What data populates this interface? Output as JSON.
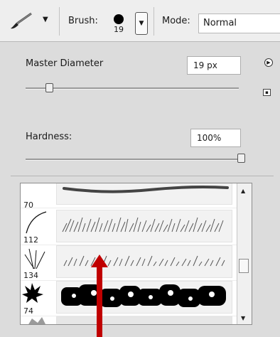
{
  "toolbar": {
    "brush_label": "Brush:",
    "brush_size": "19",
    "mode_label": "Mode:",
    "mode_value": "Normal",
    "tool_icon": "brush-icon"
  },
  "panel": {
    "master_diameter_label": "Master Diameter",
    "master_diameter_value": "19 px",
    "master_diameter_level": 0.11,
    "hardness_label": "Hardness:",
    "hardness_value": "100%",
    "hardness_level": 1.0
  },
  "brush_list": {
    "items": [
      {
        "size": "70",
        "thumb_icon": "line-brush-icon"
      },
      {
        "size": "112",
        "thumb_icon": "curved-brush-icon"
      },
      {
        "size": "134",
        "thumb_icon": "grass-brush-icon"
      },
      {
        "size": "74",
        "thumb_icon": "leaf-brush-icon"
      },
      {
        "size": "",
        "thumb_icon": "partial-brush-icon"
      }
    ],
    "scroll_position": 0.62
  },
  "annotation": {
    "icon": "red-arrow-icon",
    "color": "#c00000"
  },
  "colors": {
    "toolbar_bg": "#eeeeee",
    "panel_bg": "#dcdcdc",
    "list_bg": "#ffffff"
  }
}
